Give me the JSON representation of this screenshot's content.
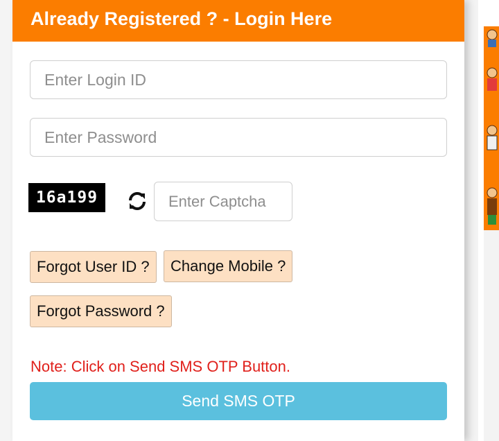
{
  "login_panel": {
    "title": "Already Registered ? - Login Here",
    "login_id_placeholder": "Enter Login ID",
    "password_placeholder": "Enter Password",
    "captcha_text": "16a199",
    "captcha_placeholder": "Enter Captcha",
    "forgot_user_id": "Forgot User ID ?",
    "change_mobile": "Change Mobile ?",
    "forgot_password": "Forgot Password ?",
    "note": "Note: Click on Send SMS OTP Button.",
    "send_otp": "Send SMS OTP"
  },
  "colors": {
    "header": "#fb7d00",
    "link_button_bg": "#fde0c3",
    "note_text": "#e0201b",
    "otp_button": "#5bc0de"
  },
  "icons": {
    "refresh": "refresh-icon"
  }
}
